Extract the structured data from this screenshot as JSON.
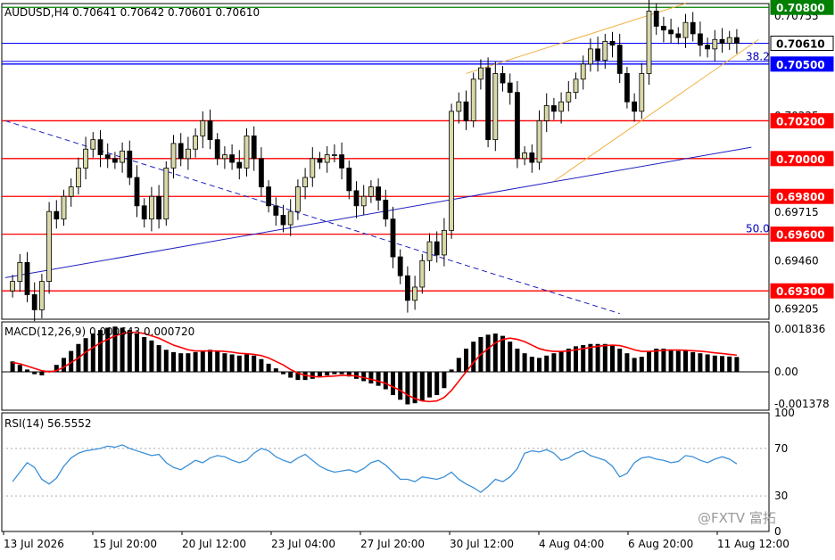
{
  "header": {
    "title": "AUDUSD,H4  0.70641 0.70642 0.70601 0.70610"
  },
  "watermark": {
    "text": "@FXTV 富拓"
  },
  "colors": {
    "bull": "#d8d8a8",
    "bear": "#000000",
    "support_line": "#ff0000",
    "current_line": "#0000ff",
    "top_line": "#008000",
    "channel": "#f0b040",
    "trend": "#2020c0",
    "macd_signal": "#ff0000",
    "rsi": "#3a8fd8"
  },
  "chart_data": [
    {
      "type": "candlestick",
      "symbol": "AUDUSD",
      "timeframe": "H4",
      "ylim": [
        0.6915,
        0.7082
      ],
      "price_ticks": [
        "0.70755",
        "0.70225",
        "0.69715",
        "0.69460",
        "0.69205"
      ],
      "levels": [
        {
          "label": "0.70800",
          "value": 0.708,
          "kind": "top"
        },
        {
          "label": "0.70610",
          "value": 0.7061,
          "kind": "current"
        },
        {
          "label": "0.70500",
          "value": 0.705,
          "kind": "blue"
        },
        {
          "label": "0.70200",
          "value": 0.702,
          "kind": "red"
        },
        {
          "label": "0.70000",
          "value": 0.7,
          "kind": "red"
        },
        {
          "label": "0.69800",
          "value": 0.698,
          "kind": "red"
        },
        {
          "label": "0.69600",
          "value": 0.696,
          "kind": "red"
        },
        {
          "label": "0.69300",
          "value": 0.693,
          "kind": "red"
        }
      ],
      "fib_labels": [
        {
          "label": "38.2",
          "value": 0.7054
        },
        {
          "label": "50.0",
          "value": 0.6963
        }
      ],
      "x_labels": [
        "13 Jul 2026",
        "15 Jul 20:00",
        "20 Jul 12:00",
        "23 Jul 04:00",
        "27 Jul 20:00",
        "30 Jul 12:00",
        "4 Aug 04:00",
        "6 Aug 20:00",
        "11 Aug 12:00"
      ],
      "closes": [
        0.6935,
        0.6945,
        0.6928,
        0.692,
        0.6935,
        0.6972,
        0.6968,
        0.698,
        0.6985,
        0.6995,
        0.7005,
        0.701,
        0.7002,
        0.7,
        0.6998,
        0.7004,
        0.699,
        0.6975,
        0.6968,
        0.698,
        0.6968,
        0.6995,
        0.7008,
        0.7,
        0.7005,
        0.7012,
        0.702,
        0.701,
        0.7,
        0.7002,
        0.6998,
        0.6995,
        0.7012,
        0.7,
        0.6985,
        0.6975,
        0.697,
        0.6965,
        0.6972,
        0.6985,
        0.699,
        0.7,
        0.6998,
        0.7002,
        0.7002,
        0.6995,
        0.6983,
        0.6975,
        0.698,
        0.6985,
        0.6978,
        0.6968,
        0.6948,
        0.6938,
        0.6925,
        0.6932,
        0.6946,
        0.6956,
        0.6949,
        0.6962,
        0.7025,
        0.703,
        0.702,
        0.7042,
        0.7048,
        0.701,
        0.7045,
        0.704,
        0.7035,
        0.7,
        0.7003,
        0.6998,
        0.702,
        0.7028,
        0.7025,
        0.703,
        0.7035,
        0.7042,
        0.705,
        0.7058,
        0.7052,
        0.7062,
        0.706,
        0.7045,
        0.703,
        0.7025,
        0.7045,
        0.7078,
        0.707,
        0.7068,
        0.7066,
        0.7064,
        0.7072,
        0.7066,
        0.706,
        0.7058,
        0.7063,
        0.7061,
        0.7064,
        0.7061
      ],
      "macd": {
        "label": "MACD(12,26,9) 0.000643 0.000720",
        "ticks": [
          "0.001836",
          "0.00",
          "-0.001378"
        ],
        "ylim": [
          -0.00165,
          0.00215
        ],
        "hist": [
          0.00045,
          0.0003,
          0.0001,
          -0.0001,
          -0.00015,
          5e-05,
          0.0003,
          0.0006,
          0.0009,
          0.0012,
          0.00145,
          0.00165,
          0.0018,
          0.0019,
          0.00195,
          0.0019,
          0.0018,
          0.00165,
          0.0015,
          0.00135,
          0.00115,
          0.00095,
          0.00085,
          0.0008,
          0.0008,
          0.00085,
          0.0009,
          0.00095,
          0.0009,
          0.0008,
          0.00075,
          0.0007,
          0.00075,
          0.0007,
          0.00055,
          0.00035,
          0.00015,
          -0.0001,
          -0.00025,
          -0.00035,
          -0.00035,
          -0.0003,
          -0.0002,
          -0.00015,
          -0.0001,
          -0.0001,
          -0.0002,
          -0.0003,
          -0.0004,
          -0.0005,
          -0.0006,
          -0.00075,
          -0.001,
          -0.0012,
          -0.0014,
          -0.00135,
          -0.00125,
          -0.0011,
          -0.001,
          -0.0007,
          0.0001,
          0.0006,
          0.001,
          0.0013,
          0.0015,
          0.0016,
          0.00165,
          0.00155,
          0.0013,
          0.001,
          0.0008,
          0.00065,
          0.0006,
          0.0007,
          0.0008,
          0.0009,
          0.001,
          0.0011,
          0.00115,
          0.0012,
          0.0012,
          0.0012,
          0.00115,
          0.001,
          0.0008,
          0.0006,
          0.00065,
          0.0009,
          0.001,
          0.001,
          0.00095,
          0.0009,
          0.0009,
          0.00085,
          0.0008,
          0.00075,
          0.0007,
          0.00068,
          0.00066,
          0.00064
        ],
        "signal": [
          0.0004,
          0.00035,
          0.00025,
          0.00015,
          5e-05,
          0.0,
          5e-05,
          0.0002,
          0.0004,
          0.0006,
          0.00085,
          0.00105,
          0.00125,
          0.0014,
          0.00155,
          0.00165,
          0.0017,
          0.0017,
          0.00165,
          0.00155,
          0.00145,
          0.0013,
          0.00115,
          0.00105,
          0.00095,
          0.0009,
          0.0009,
          0.0009,
          0.0009,
          0.00088,
          0.00085,
          0.0008,
          0.00078,
          0.00075,
          0.0007,
          0.0006,
          0.00045,
          0.0003,
          0.0001,
          -5e-05,
          -0.00015,
          -0.0002,
          -0.00022,
          -0.0002,
          -0.00018,
          -0.00015,
          -0.00015,
          -0.00018,
          -0.00025,
          -0.00032,
          -0.0004,
          -0.0005,
          -0.00065,
          -0.0008,
          -0.001,
          -0.00115,
          -0.00125,
          -0.00128,
          -0.00125,
          -0.0011,
          -0.0008,
          -0.0004,
          0.0,
          0.0004,
          0.00075,
          0.001,
          0.00125,
          0.0014,
          0.00145,
          0.0014,
          0.0013,
          0.00115,
          0.001,
          0.00092,
          0.00088,
          0.00088,
          0.0009,
          0.00095,
          0.001,
          0.00105,
          0.0011,
          0.00113,
          0.00115,
          0.00113,
          0.00105,
          0.00095,
          0.00088,
          0.00088,
          0.0009,
          0.00093,
          0.00094,
          0.00094,
          0.00093,
          0.00091,
          0.00089,
          0.00086,
          0.00082,
          0.00079,
          0.00075,
          0.00072
        ]
      },
      "rsi": {
        "label": "RSI(14) 56.5552",
        "ticks": [
          "100",
          "70",
          "30",
          "0"
        ],
        "ylim": [
          0,
          100
        ],
        "values": [
          42,
          50,
          58,
          54,
          44,
          40,
          45,
          55,
          62,
          66,
          68,
          69,
          70,
          72,
          71,
          73,
          70,
          68,
          66,
          64,
          65,
          58,
          54,
          52,
          56,
          60,
          58,
          62,
          64,
          63,
          60,
          58,
          60,
          66,
          70,
          68,
          63,
          60,
          58,
          62,
          65,
          60,
          55,
          52,
          50,
          51,
          52,
          50,
          53,
          58,
          60,
          56,
          50,
          44,
          44,
          42,
          46,
          45,
          44,
          46,
          50,
          44,
          40,
          37,
          33,
          38,
          44,
          42,
          46,
          53,
          66,
          68,
          67,
          69,
          66,
          60,
          62,
          66,
          68,
          64,
          62,
          60,
          55,
          46,
          49,
          58,
          62,
          63,
          61,
          60,
          58,
          59,
          64,
          63,
          60,
          58,
          61,
          63,
          61,
          57
        ]
      }
    }
  ]
}
